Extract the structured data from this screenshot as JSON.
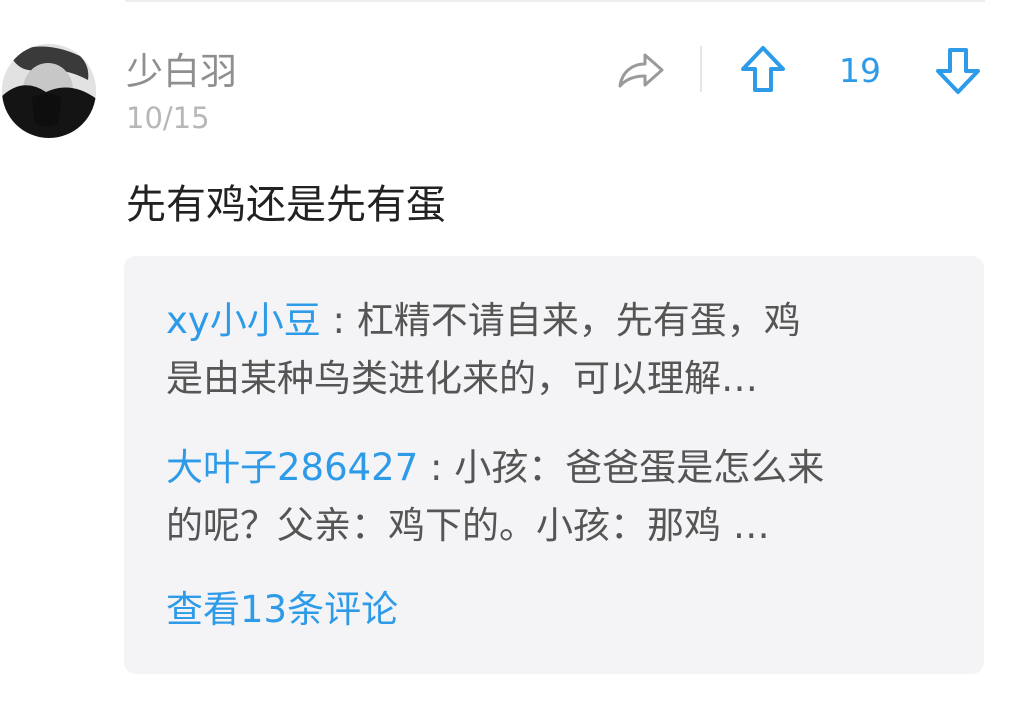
{
  "post": {
    "username": "少白羽",
    "date": "10/15",
    "content": "先有鸡还是先有蛋",
    "vote_count": "19"
  },
  "replies": [
    {
      "author": "xy小小豆",
      "line1": " : 杠精不请自来，先有蛋，鸡",
      "line2": "是由某种鸟类进化来的，可以理解…"
    },
    {
      "author": "大叶子286427",
      "line1": " : 小孩：爸爸蛋是怎么来",
      "line2": "的呢？父亲：鸡下的。小孩：那鸡 …"
    }
  ],
  "see_more_label": "查看13条评论",
  "colors": {
    "accent": "#2e9be8",
    "username": "#8f8f8f",
    "date": "#b7b7b7",
    "body_text": "#222222",
    "reply_text": "#555555",
    "reply_background": "#f4f4f6",
    "share_icon": "#9a9a9a"
  },
  "icons": {
    "share": "share-arrow-icon",
    "upvote": "arrow-up-icon",
    "downvote": "arrow-down-icon"
  }
}
